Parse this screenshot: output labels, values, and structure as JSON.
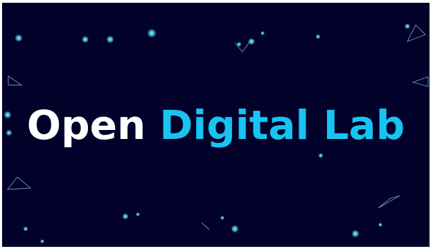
{
  "logo": {
    "word_primary": "Open",
    "word_accent": "Digital Lab"
  },
  "colors": {
    "background": "#01012a",
    "primary_text": "#ffffff",
    "accent_text": "#19c3f0",
    "particle": "#5fd8f5",
    "outline": "#7fb8d6"
  }
}
